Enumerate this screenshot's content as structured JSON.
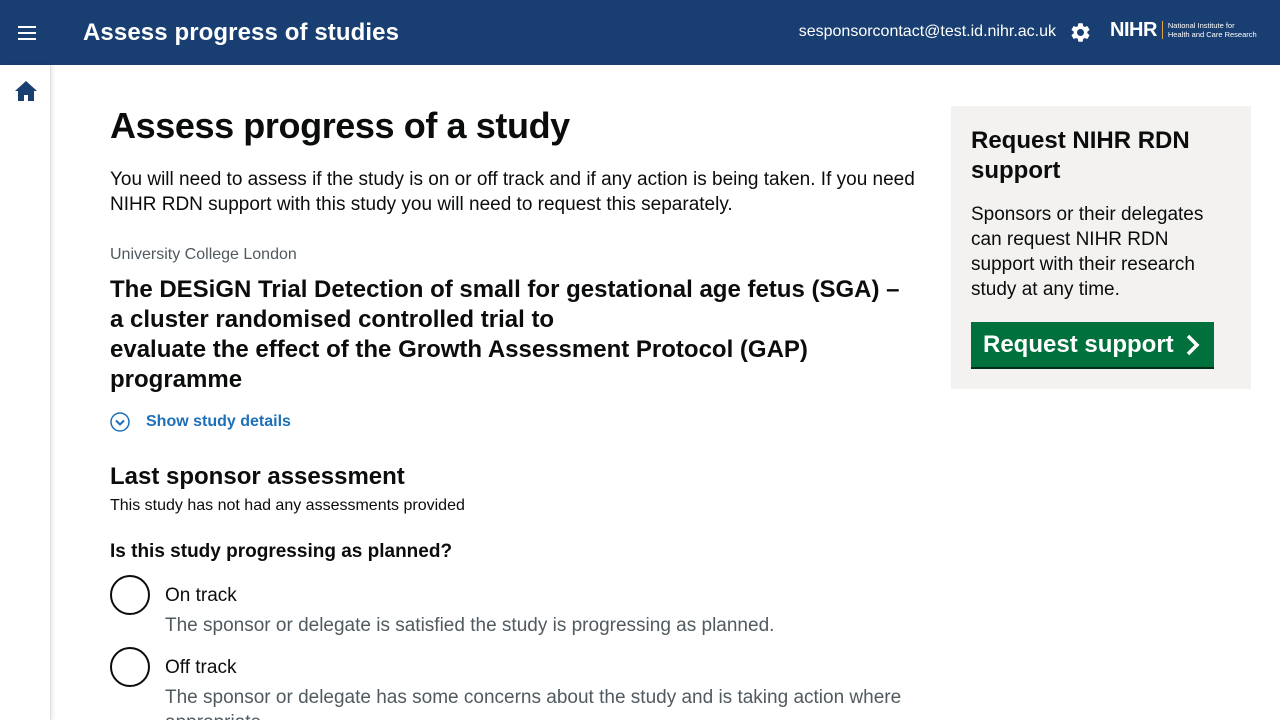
{
  "header": {
    "title": "Assess progress of studies",
    "user_email": "sesponsorcontact@test.id.nihr.ac.uk",
    "menu_icon": "hamburger-menu-icon",
    "settings_icon": "gear-icon",
    "logo": {
      "main": "NIHR",
      "sub_line1": "National Institute for",
      "sub_line2": "Health and Care Research"
    },
    "bg_color": "#193e72"
  },
  "sidenav": {
    "home_icon": "home-icon"
  },
  "main": {
    "page_title": "Assess progress of a study",
    "intro": "You will need to assess if the study is on or off track and if any action is being taken. If you need NIHR RDN support with this study you will need to request this separately.",
    "organisation": "University College London",
    "study_title": "The DESiGN Trial  Detection of small for gestational age fetus (SGA) –\na cluster randomised controlled trial to\nevaluate the effect of the Growth Assessment Protocol (GAP) programme",
    "show_details_label": "Show study details",
    "last_assessment_heading": "Last sponsor assessment",
    "last_assessment_note": "This study has not had any assessments provided",
    "question": "Is this study progressing as planned?",
    "options": [
      {
        "label": "On track",
        "hint": "The sponsor or delegate is satisfied the study is progressing as planned.",
        "selected": false
      },
      {
        "label": "Off track",
        "hint": "The sponsor or delegate has some concerns about the study and is taking action where appropriate.",
        "selected": false
      }
    ]
  },
  "aside": {
    "title": "Request NIHR RDN support",
    "text": "Sponsors or their delegates can request NIHR RDN support with their research study at any time.",
    "button_label": "Request support",
    "button_color": "#00703c"
  }
}
